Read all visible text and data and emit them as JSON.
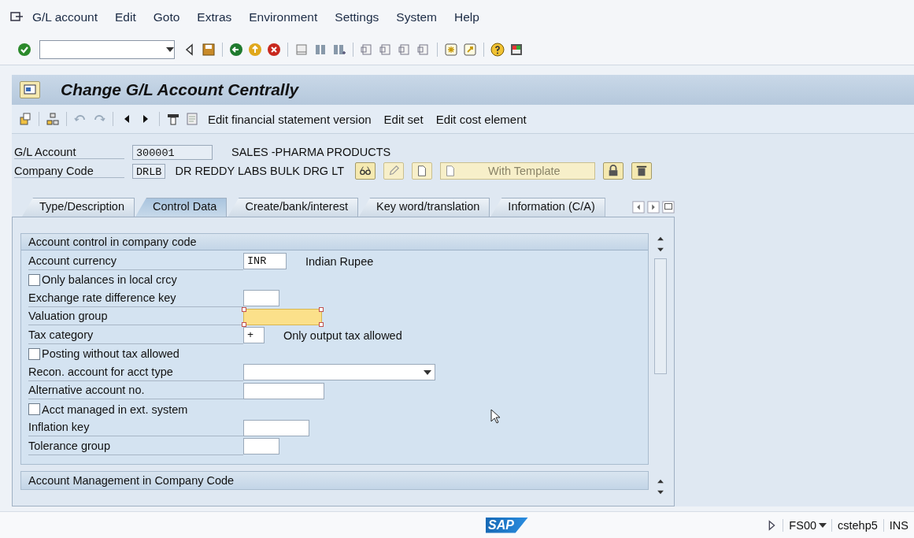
{
  "menu": [
    "G/L account",
    "Edit",
    "Goto",
    "Extras",
    "Environment",
    "Settings",
    "System",
    "Help"
  ],
  "title": "Change G/L Account Centrally",
  "app_toolbar": [
    "Edit financial statement version",
    "Edit set",
    "Edit cost element"
  ],
  "header": {
    "gl_account": {
      "label": "G/L Account",
      "value": "300001",
      "description": "SALES -PHARMA PRODUCTS"
    },
    "company_code": {
      "label": "Company Code",
      "value": "DRLB",
      "description": "DR REDDY LABS BULK DRG LT"
    },
    "template_button": "With Template"
  },
  "tabs": [
    {
      "label": "Type/Description",
      "selected": false
    },
    {
      "label": "Control Data",
      "selected": true
    },
    {
      "label": "Create/bank/interest",
      "selected": false
    },
    {
      "label": "Key word/translation",
      "selected": false
    },
    {
      "label": "Information (C/A)",
      "selected": false
    }
  ],
  "section": {
    "title": "Account control in company code",
    "rows": [
      {
        "kind": "field",
        "label": "Account currency",
        "value": "INR",
        "description": "Indian Rupee",
        "focused": false
      },
      {
        "kind": "checkbox",
        "label": "Only balances in local crcy",
        "checked": false
      },
      {
        "kind": "field",
        "label": "Exchange rate difference key",
        "value": "",
        "focused": false
      },
      {
        "kind": "field",
        "label": "Valuation group",
        "value": "",
        "focused": true
      },
      {
        "kind": "field",
        "label": "Tax category",
        "value": "+",
        "description": "Only output tax allowed",
        "focused": false
      },
      {
        "kind": "checkbox",
        "label": "Posting without tax allowed",
        "checked": false
      },
      {
        "kind": "dropdown",
        "label": "Recon. account for acct type",
        "value": ""
      },
      {
        "kind": "field",
        "label": "Alternative account no.",
        "value": "",
        "focused": false
      },
      {
        "kind": "checkbox",
        "label": "Acct managed in ext. system",
        "checked": false
      },
      {
        "kind": "field",
        "label": "Inflation key",
        "value": "",
        "focused": false
      },
      {
        "kind": "field",
        "label": "Tolerance group",
        "value": "",
        "focused": false
      }
    ]
  },
  "next_section": {
    "title": "Account Management in Company Code"
  },
  "status_bar": {
    "logo": "SAP",
    "transaction": "FS00",
    "server": "cstehp5",
    "mode": "INS"
  }
}
